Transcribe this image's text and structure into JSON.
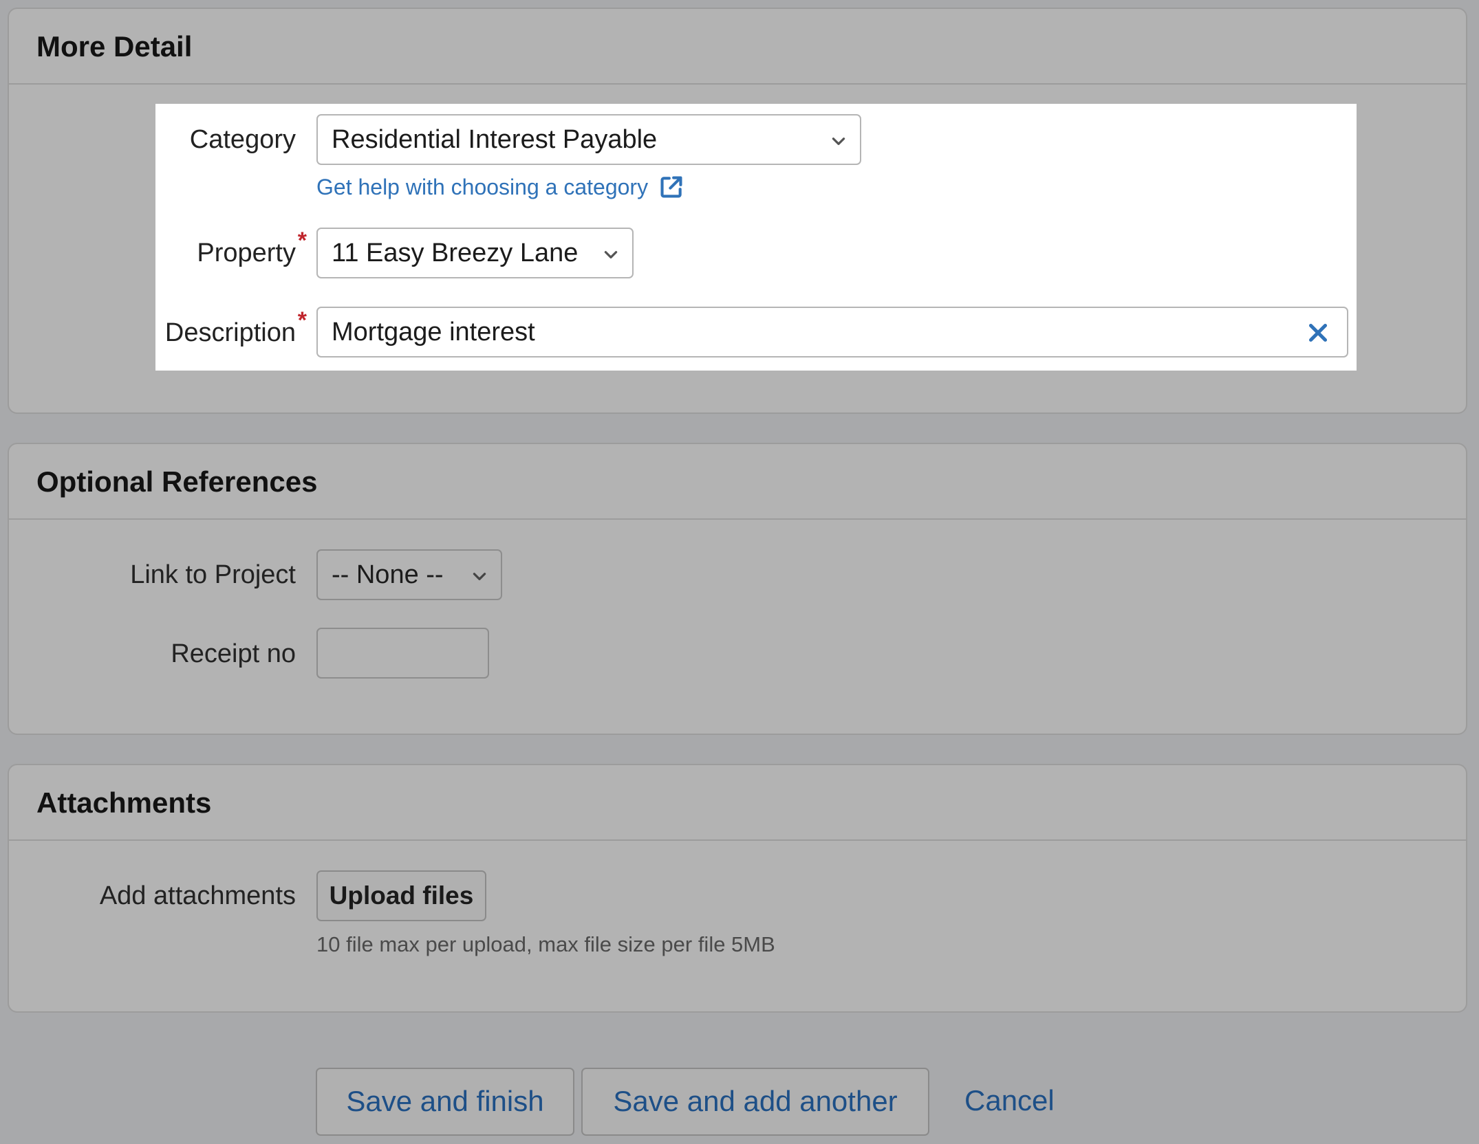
{
  "more_detail": {
    "title": "More Detail",
    "category": {
      "label": "Category",
      "value": "Residential Interest Payable",
      "help_link": "Get help with choosing a category"
    },
    "property": {
      "label": "Property",
      "required_mark": "*",
      "value": "11 Easy Breezy Lane"
    },
    "description": {
      "label": "Description",
      "required_mark": "*",
      "value": "Mortgage interest"
    }
  },
  "optional_references": {
    "title": "Optional References",
    "link_to_project": {
      "label": "Link to Project",
      "value": "-- None --"
    },
    "receipt_no": {
      "label": "Receipt no",
      "value": ""
    }
  },
  "attachments": {
    "title": "Attachments",
    "add_label": "Add attachments",
    "upload_button": "Upload files",
    "hint": "10 file max per upload, max file size per file 5MB"
  },
  "actions": {
    "save_finish": "Save and finish",
    "save_add_another": "Save and add another",
    "cancel": "Cancel"
  },
  "colors": {
    "link": "#2f72b8",
    "action_text": "#1d4f87",
    "required": "#c0262d",
    "overlay_bg": "#b3b3b3",
    "highlight_bg": "#ffffff"
  },
  "icons": {
    "dropdown": "chevron-down-icon",
    "external_link": "external-link-icon",
    "clear": "close-icon"
  }
}
